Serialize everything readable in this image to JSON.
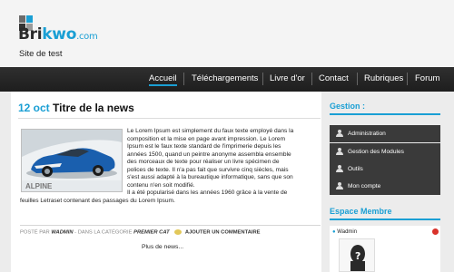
{
  "brand": {
    "name_part1": "Bri",
    "name_part2": "kwo",
    "name_part3": ".com",
    "subtitle": "Site de test"
  },
  "nav": {
    "items": [
      "Accueil",
      "Téléchargements",
      "Livre d'or",
      "Contact",
      "Rubriques",
      "Forum"
    ],
    "active": "Accueil"
  },
  "post": {
    "date": "12 oct",
    "title": "Titre de la news",
    "image_label": "ALPINE",
    "body_wrap": [
      "Le Lorem Ipsum est simplement du faux texte employé dans la",
      "composition et la mise en page avant impression. Le Lorem",
      "Ipsum est le faux texte standard de l'imprimerie depuis les",
      "années 1500, quand un peintre anonyme assembla ensemble",
      "des morceaux de texte pour réaliser un livre spécimen de",
      "polices de texte. Il n'a pas fait que survivre cinq siècles, mais",
      "s'est aussi adapté à la bureautique informatique, sans que son",
      "contenu n'en soit modifié.",
      "Il a été popularisé dans les années 1960 grâce à la vente de"
    ],
    "body_full": "feuilles Letraset contenant des passages du Lorem Ipsum.",
    "meta": {
      "posted_by": "Posté par",
      "author": "Wadmin",
      "category_label": "dans la catégorie",
      "category": "Premier cat",
      "comment": "Ajouter un commentaire"
    },
    "read_more": "Plus de news..."
  },
  "sidebar": {
    "gestion_title": "Gestion :",
    "gestion_items": [
      "Administration",
      "Gestion des Modules",
      "Outils",
      "Mon compte"
    ],
    "member_title": "Espace Membre",
    "member_name": "Wadmin"
  },
  "colors": {
    "accent": "#1a9fd4",
    "dark": "#2a2a2a",
    "sidebar_item": "#3a3a3a"
  }
}
